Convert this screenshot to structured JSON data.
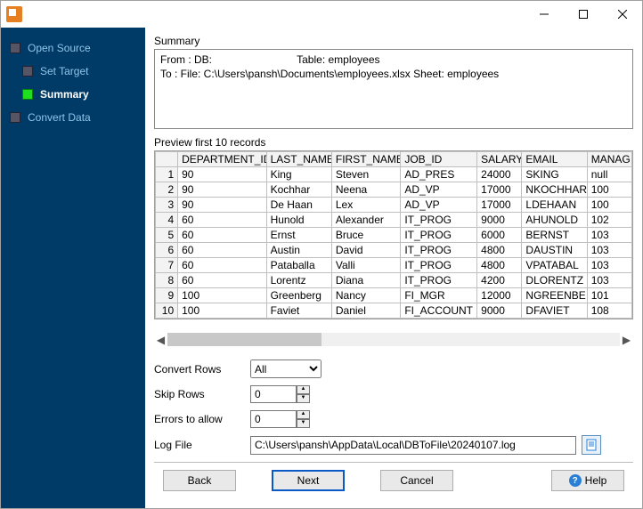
{
  "nav": [
    {
      "label": "Open Source",
      "active": false
    },
    {
      "label": "Set Target",
      "active": false
    },
    {
      "label": "Summary",
      "active": true
    },
    {
      "label": "Convert Data",
      "active": false
    }
  ],
  "summary": {
    "section_label": "Summary",
    "line1_prefix": "From : DB:",
    "line1_table": "Table: employees",
    "line2": "To : File: C:\\Users\\pansh\\Documents\\employees.xlsx Sheet: employees"
  },
  "preview": {
    "label": "Preview first 10 records",
    "columns": [
      "DEPARTMENT_ID",
      "LAST_NAME",
      "FIRST_NAME",
      "JOB_ID",
      "SALARY",
      "EMAIL",
      "MANAG"
    ],
    "rows": [
      [
        "90",
        "King",
        "Steven",
        "AD_PRES",
        "24000",
        "SKING",
        "null"
      ],
      [
        "90",
        "Kochhar",
        "Neena",
        "AD_VP",
        "17000",
        "NKOCHHAR",
        "100"
      ],
      [
        "90",
        "De Haan",
        "Lex",
        "AD_VP",
        "17000",
        "LDEHAAN",
        "100"
      ],
      [
        "60",
        "Hunold",
        "Alexander",
        "IT_PROG",
        "9000",
        "AHUNOLD",
        "102"
      ],
      [
        "60",
        "Ernst",
        "Bruce",
        "IT_PROG",
        "6000",
        "BERNST",
        "103"
      ],
      [
        "60",
        "Austin",
        "David",
        "IT_PROG",
        "4800",
        "DAUSTIN",
        "103"
      ],
      [
        "60",
        "Pataballa",
        "Valli",
        "IT_PROG",
        "4800",
        "VPATABAL",
        "103"
      ],
      [
        "60",
        "Lorentz",
        "Diana",
        "IT_PROG",
        "4200",
        "DLORENTZ",
        "103"
      ],
      [
        "100",
        "Greenberg",
        "Nancy",
        "FI_MGR",
        "12000",
        "NGREENBE",
        "101"
      ],
      [
        "100",
        "Faviet",
        "Daniel",
        "FI_ACCOUNT",
        "9000",
        "DFAVIET",
        "108"
      ]
    ]
  },
  "form": {
    "convert_rows_label": "Convert Rows",
    "convert_rows_value": "All",
    "skip_rows_label": "Skip Rows",
    "skip_rows_value": "0",
    "errors_label": "Errors to allow",
    "errors_value": "0",
    "log_label": "Log File",
    "log_value": "C:\\Users\\pansh\\AppData\\Local\\DBToFile\\20240107.log"
  },
  "footer": {
    "back": "Back",
    "next": "Next",
    "cancel": "Cancel",
    "help": "Help"
  }
}
